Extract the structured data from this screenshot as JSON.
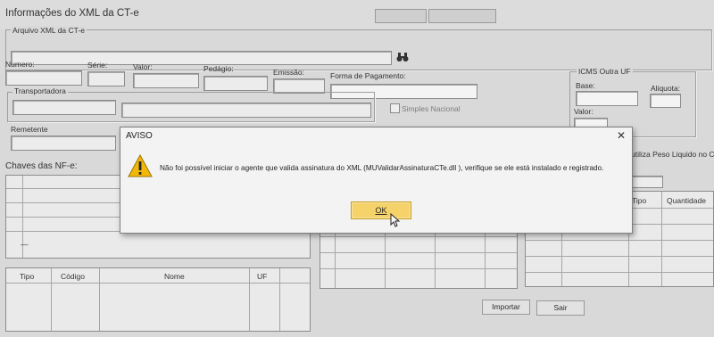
{
  "window": {
    "title": "Informações do XML da CT-e"
  },
  "xml_section": {
    "label": "Arquivo XML da CT-e",
    "search_icon": "binoculars-icon"
  },
  "fields": {
    "numero": "Numero:",
    "serie": "Série:",
    "valor": "Valor:",
    "pedagio": "Pedágio:",
    "emissao": "Emissão:",
    "forma_pagamento": "Forma de Pagamento:",
    "transportadora": "Transportadora",
    "simples_nacional": "Simples Nacional",
    "remetente": "Remetente"
  },
  "icms": {
    "title": "ICMS Outra UF",
    "base": "Base:",
    "aliquota": "Aliquota:",
    "valor": "Valor:"
  },
  "right_clipped": "utiliza Peso Liquido no CT",
  "chaves": {
    "label": "Chaves das NF-e:",
    "dash": "—"
  },
  "products_table": {
    "headers": [
      "Tipo",
      "Quantidade"
    ]
  },
  "lower_table": {
    "headers": [
      "Tipo",
      "Código",
      "Nome",
      "UF"
    ]
  },
  "buttons": {
    "importar": "Importar",
    "sair": "Sair"
  },
  "dialog": {
    "title": "AVISO",
    "message": "Não foi possível iniciar o agente que valida assinatura do XML (MUValidarAssinaturaCTe.dll ), verifique se ele está instalado e registrado.",
    "ok": "OK",
    "close": "✕",
    "icon": "warning-icon"
  },
  "colors": {
    "ok_button": "#f5d36a",
    "warning": "#f2b807"
  }
}
